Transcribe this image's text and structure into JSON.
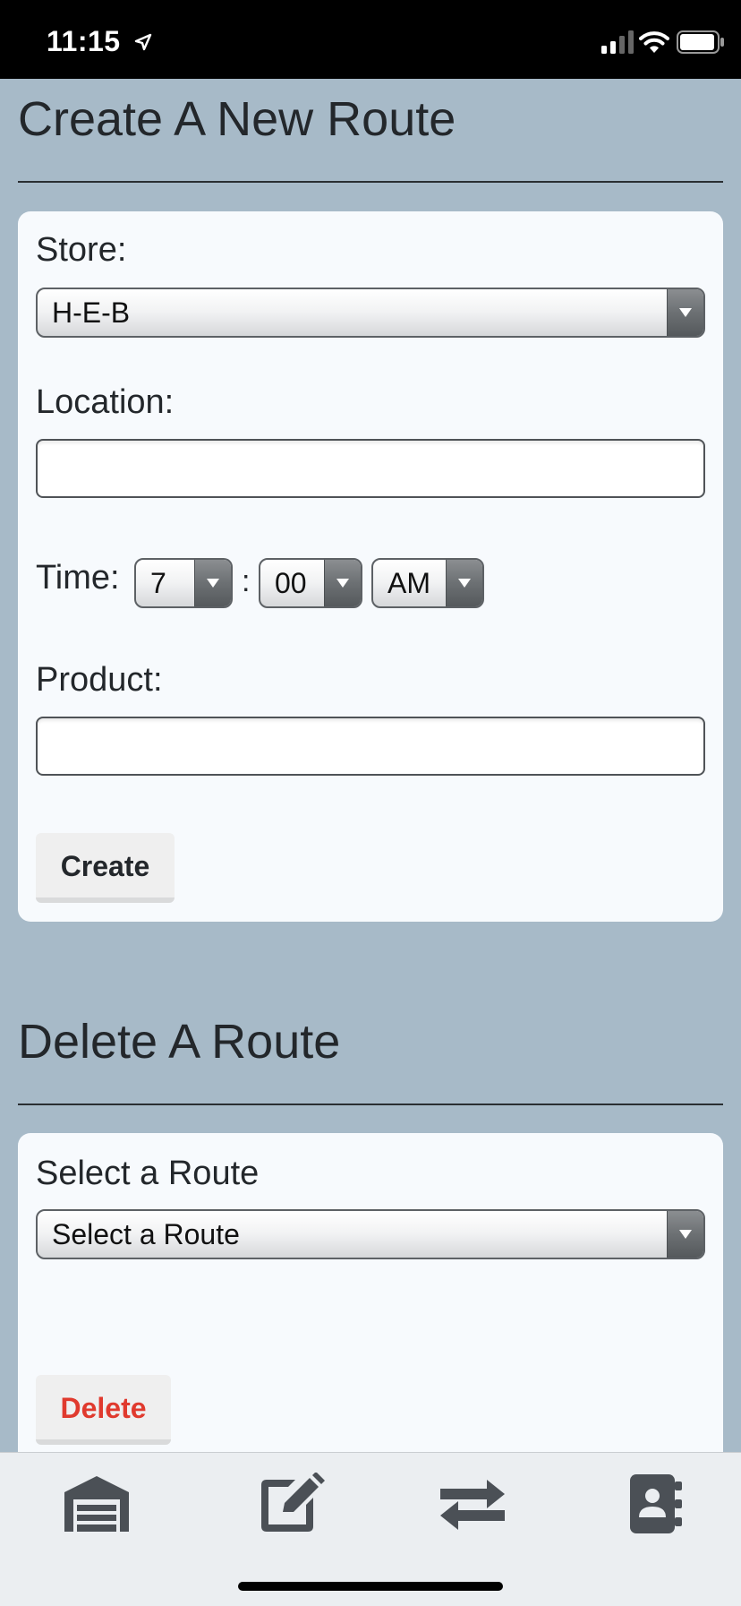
{
  "status_bar": {
    "time": "11:15"
  },
  "create_section": {
    "title": "Create A New Route",
    "store_label": "Store:",
    "store_value": "H-E-B",
    "location_label": "Location:",
    "location_value": "",
    "time_label": "Time:",
    "time_hour": "7",
    "time_separator": ":",
    "time_minute": "00",
    "time_period": "AM",
    "product_label": "Product:",
    "product_value": "",
    "create_button": "Create"
  },
  "delete_section": {
    "title": "Delete A Route",
    "select_label": "Select a Route",
    "select_value": "Select a Route",
    "delete_button": "Delete",
    "delete_color": "#e03a2e"
  },
  "tab_bar": {
    "tabs": [
      {
        "icon": "warehouse-icon"
      },
      {
        "icon": "edit-icon"
      },
      {
        "icon": "exchange-icon"
      },
      {
        "icon": "contact-book-icon"
      }
    ]
  }
}
